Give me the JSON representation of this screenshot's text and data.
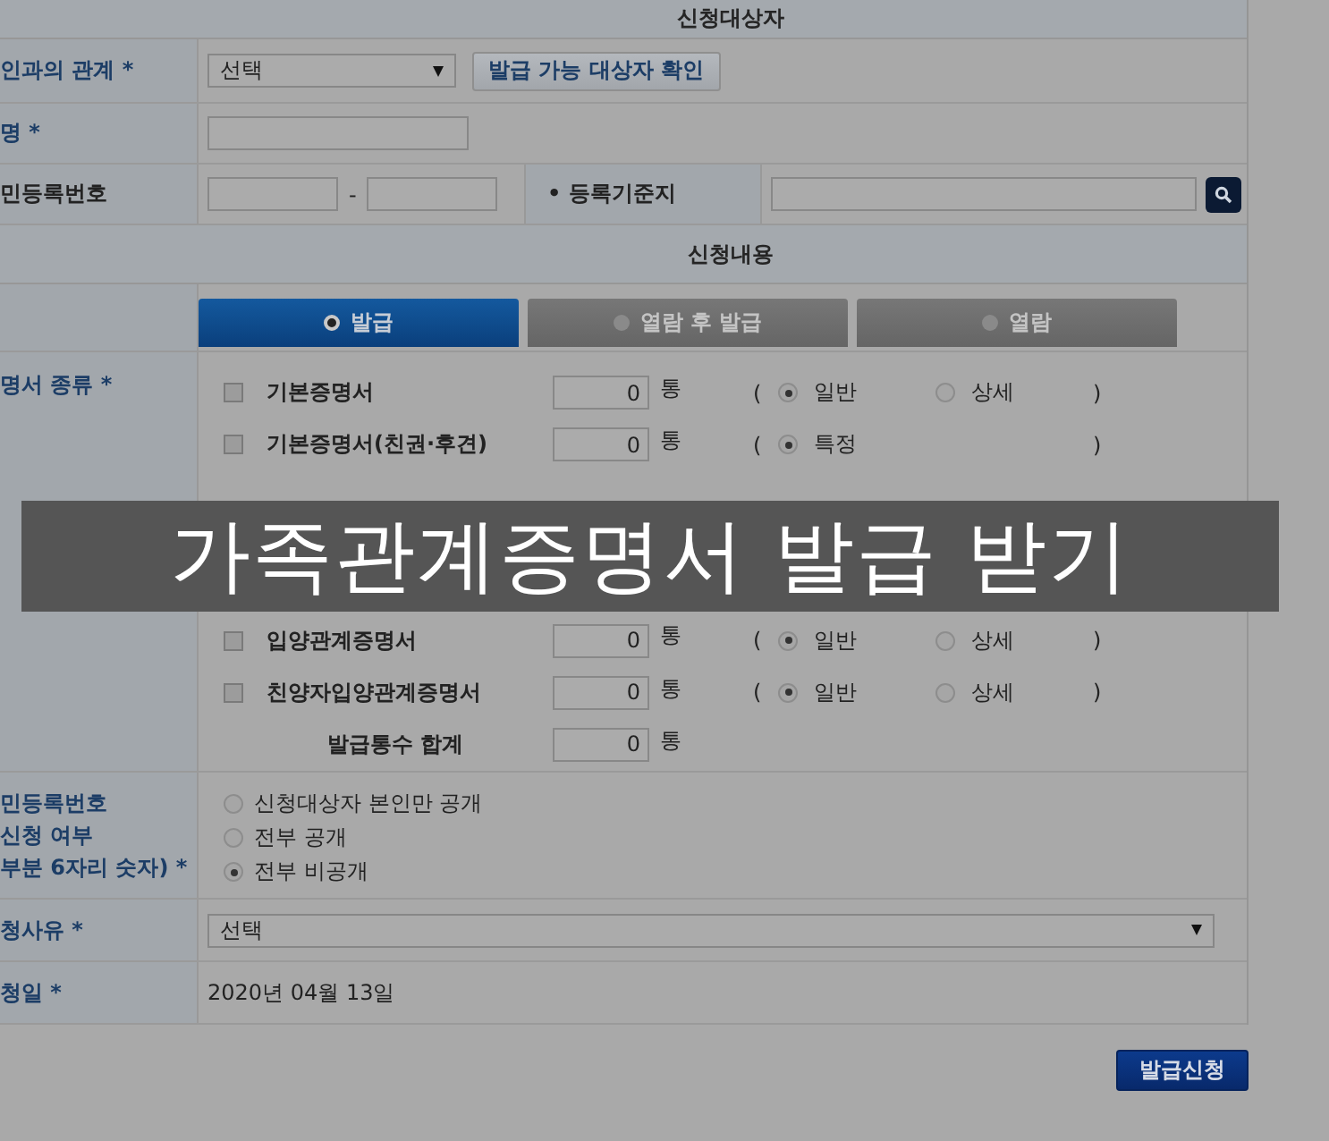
{
  "overlay_caption": "가족관계증명서 발급 받기",
  "target_section": {
    "title": "신청대상자",
    "relation": {
      "label": "인과의 관계 *",
      "value": "선택",
      "button": "발급 가능 대상자 확인"
    },
    "name": {
      "label": "명 *"
    },
    "id_number": {
      "label": "민등록번호",
      "separator": "-",
      "registry_label": "• 등록기준지"
    }
  },
  "content_section": {
    "title": "신청내용",
    "modes": [
      {
        "label": "발급",
        "selected": true
      },
      {
        "label": "열람 후 발급",
        "selected": false
      },
      {
        "label": "열람",
        "selected": false
      }
    ],
    "certificates_label": "명서 종류 *",
    "certificates": [
      {
        "name": "기본증명서",
        "checked": false,
        "count": "0",
        "unit": "통",
        "open": "(",
        "close": ")",
        "options": [
          {
            "label": "일반",
            "selected": true
          },
          {
            "label": "상세",
            "selected": false
          }
        ]
      },
      {
        "name": "기본증명서(친권·후견)",
        "checked": false,
        "count": "0",
        "unit": "통",
        "open": "(",
        "close": ")",
        "options": [
          {
            "label": "특정",
            "selected": true
          }
        ]
      },
      {
        "name": "입양관계증명서",
        "checked": false,
        "count": "0",
        "unit": "통",
        "open": "(",
        "close": ")",
        "options": [
          {
            "label": "일반",
            "selected": true
          },
          {
            "label": "상세",
            "selected": false
          }
        ]
      },
      {
        "name": "친양자입양관계증명서",
        "checked": false,
        "count": "0",
        "unit": "통",
        "open": "(",
        "close": ")",
        "options": [
          {
            "label": "일반",
            "selected": true
          },
          {
            "label": "상세",
            "selected": false
          }
        ]
      }
    ],
    "total": {
      "label": "발급통수 합계",
      "count": "0",
      "unit": "통"
    },
    "disclosure": {
      "label_lines": [
        "민등록번호",
        "신청 여부",
        "부분 6자리 숫자) *"
      ],
      "options": [
        {
          "label": "신청대상자 본인만 공개",
          "selected": false
        },
        {
          "label": "전부 공개",
          "selected": false
        },
        {
          "label": "전부 비공개",
          "selected": true
        }
      ]
    },
    "reason": {
      "label": "청사유 *",
      "value": "선택"
    },
    "date": {
      "label": "청일 *",
      "value": "2020년 04월 13일"
    }
  },
  "submit_button": "발급신청"
}
